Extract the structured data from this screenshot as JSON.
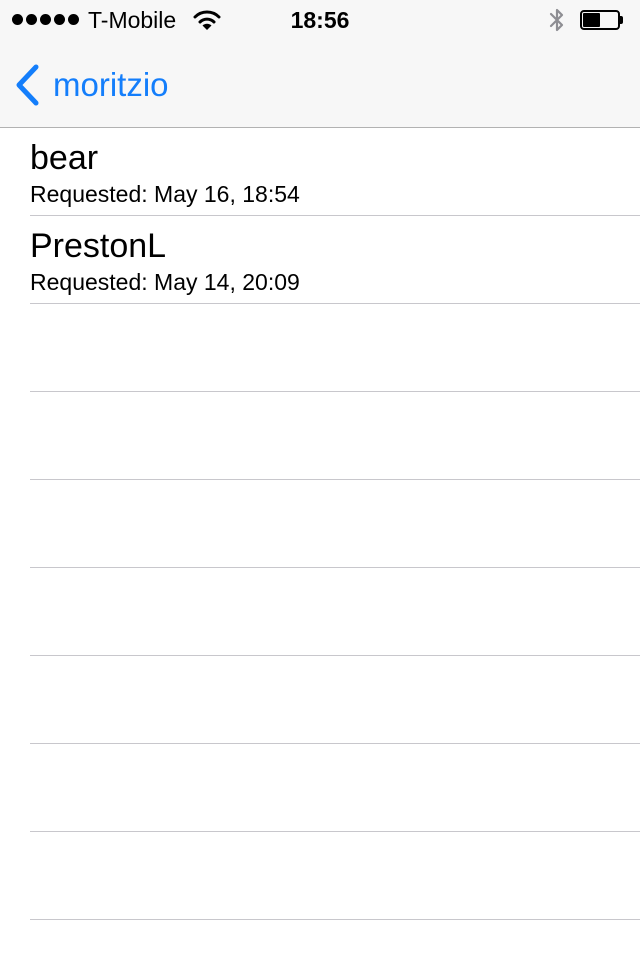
{
  "status_bar": {
    "carrier": "T-Mobile",
    "time": "18:56",
    "signal_icon": "signal-dots-icon",
    "wifi_icon": "wifi-icon",
    "bluetooth_icon": "bluetooth-icon",
    "battery_icon": "battery-icon",
    "battery_level": 0.5
  },
  "nav": {
    "back_label": "moritzio",
    "back_icon": "chevron-left-icon",
    "accent_color": "#147efb"
  },
  "requests": [
    {
      "name": "bear",
      "requested": "Requested: May 16, 18:54"
    },
    {
      "name": "PrestonL",
      "requested": "Requested: May 14, 20:09"
    }
  ],
  "empty_rows": 7
}
